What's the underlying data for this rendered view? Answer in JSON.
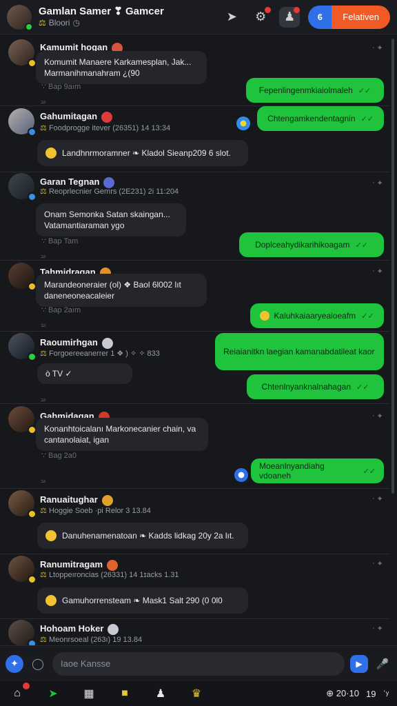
{
  "header": {
    "title": "Gamlan Samer ❣ Gamcer",
    "subtitle_tag": "⚖",
    "subtitle": "Bloori",
    "cta_left": "ϐ",
    "cta_right": "Felativen"
  },
  "messages": [
    {
      "name": "Kamumit hogan",
      "line1": "Komumit Manaere Karkamesplan, Jak...",
      "line2": "Marmanihmanahram ¿(90",
      "date": "∵ Bap 9aım",
      "num": "ᩞ"
    },
    {
      "name": "Gahumitagan",
      "meta": "Foodprogge itever (26351)  14  13:34",
      "text": "Landhnrmoramner ❧ Kladol Sieanp209 6 slot."
    },
    {
      "name": "Garan Tegnan",
      "meta": "Reoprlecnier Gemrs (2E231)  2i  11:204",
      "line1": "Onam Semonka Satan skaingan...",
      "line2": "Vatamantiaraman ygo",
      "date": "∵ Bap Tam",
      "num": "ᩞ"
    },
    {
      "name": "Tahmidragan",
      "line1": "Marandeoneraier (ol) ❖ Baol 6l002 lıt",
      "line2": "daneneoneacaleier",
      "date": "∵ Bap 2aım",
      "num": "ᩞ"
    },
    {
      "name": "Raoumirhgan",
      "meta": "Forgoereeanerrer 1  ❖ ) ✧  ✧  833",
      "line1": "ò TV      ✓",
      "num": "ᩞ"
    },
    {
      "name": "Gahmidagan",
      "line1": "Konanhtoicalanı Markonecanier chain, va",
      "line2": "cantanolaiat, igan",
      "date": "∵ Bag 2a0",
      "num": "ᩞ"
    },
    {
      "name": "Ranuaitughar",
      "meta": "Hoggie Soeb   ·pi   Relor  3  13.84",
      "text": "Danuhenamenatoan ❧ Kadds lidkag 20y 2a lıt."
    },
    {
      "name": "Ranumitragam",
      "meta": "Ltoppeıroncias (26331)  14  1ɪacks  1.31",
      "text": "Gamuhorrensteam ❧ Mask1 Salt 290 (0 0l0"
    },
    {
      "name": "Hohoam Hoker",
      "meta": "Meonrsoeal (263ı) 19  13.84"
    }
  ],
  "outgoing": [
    "Fepenlingenmkiaiolmaleh",
    "Chtengamkendentagnin",
    "Doplceahydikarihikoagam",
    "Kaluhkaiaaryeaioeafm",
    "Reiaianitkn laegian kamanabdatileat kaor",
    "Chtenlnyanknalnahagan",
    "Moeanlnyandiahg vdoaneh"
  ],
  "corner_mark": "‧ ✦",
  "checkmark": "✓✓",
  "composer": {
    "placeholder": "Iaoe Kansse"
  },
  "bottombar": {
    "count": "⊕ 20·10",
    "num": "19",
    "icon": "ʿʸ"
  },
  "colors": {
    "accent": "#2f6fe8",
    "outgoing": "#20c33c",
    "cta": "#f15a24",
    "badge": "#e53935"
  }
}
